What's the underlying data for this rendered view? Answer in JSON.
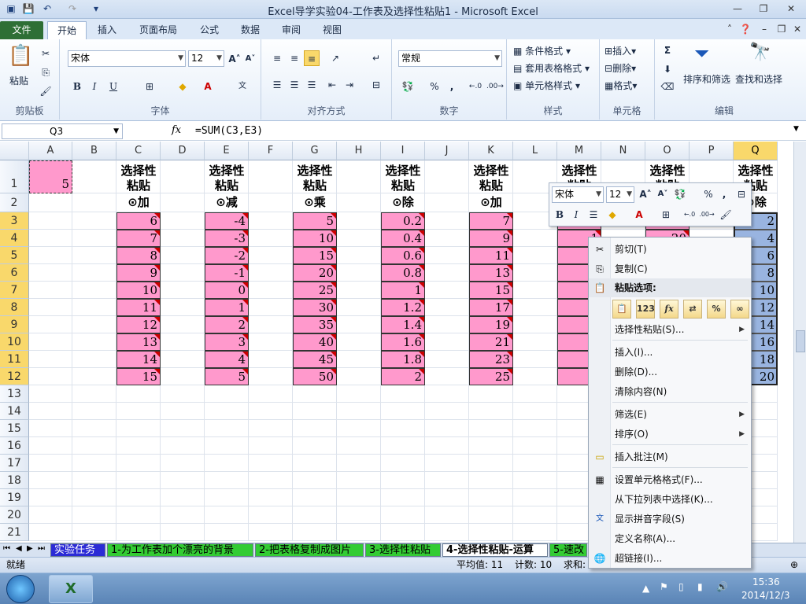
{
  "window": {
    "title": "Excel导学实验04-工作表及选择性粘贴1  -  Microsoft Excel"
  },
  "tabs": [
    "文件",
    "开始",
    "插入",
    "页面布局",
    "公式",
    "数据",
    "审阅",
    "视图"
  ],
  "ribbon": {
    "clipboard": {
      "paste": "粘贴",
      "label": "剪贴板"
    },
    "font": {
      "name": "宋体",
      "size": "12",
      "label": "字体"
    },
    "alignment": {
      "label": "对齐方式"
    },
    "number": {
      "format": "常规",
      "percent": "%",
      "comma": ",",
      "label": "数字"
    },
    "styles": {
      "conditional": "条件格式",
      "table": "套用表格格式",
      "cell": "单元格样式",
      "label": "样式"
    },
    "cells": {
      "insert": "插入",
      "delete": "删除",
      "format": "格式",
      "label": "单元格"
    },
    "editing": {
      "sort": "排序和筛选",
      "find": "查找和选择",
      "label": "编辑"
    }
  },
  "formula_bar": {
    "name_box": "Q3",
    "fx": "fx",
    "formula": "=SUM(C3,E3)"
  },
  "columns": [
    "A",
    "B",
    "C",
    "D",
    "E",
    "F",
    "G",
    "H",
    "I",
    "J",
    "K",
    "L",
    "M",
    "N",
    "O",
    "P",
    "Q"
  ],
  "rows": [
    "1",
    "2",
    "3",
    "4",
    "5",
    "6",
    "7",
    "8",
    "9",
    "10",
    "11",
    "12",
    "13",
    "14",
    "15",
    "16",
    "17",
    "18",
    "19",
    "20",
    "21"
  ],
  "sheet": {
    "a1": "5",
    "header_line1": "选择性",
    "header_line2": "粘贴",
    "ops": {
      "c": "⊙加",
      "e": "⊙减",
      "g": "⊙乘",
      "i": "⊙除",
      "k": "⊙加",
      "q": "⊙除"
    },
    "col_c": [
      "6",
      "7",
      "8",
      "9",
      "10",
      "11",
      "12",
      "13",
      "14",
      "15"
    ],
    "col_e": [
      "-4",
      "-3",
      "-2",
      "-1",
      "0",
      "1",
      "2",
      "3",
      "4",
      "5"
    ],
    "col_g": [
      "5",
      "10",
      "15",
      "20",
      "25",
      "30",
      "35",
      "40",
      "45",
      "50"
    ],
    "col_i": [
      "0.2",
      "0.4",
      "0.6",
      "0.8",
      "1",
      "1.2",
      "1.4",
      "1.6",
      "1.8",
      "2"
    ],
    "col_k": [
      "7",
      "9",
      "11",
      "13",
      "15",
      "17",
      "19",
      "21",
      "23",
      "25"
    ],
    "col_m_partial": [
      "0",
      "1",
      "2",
      "3",
      "4",
      "5",
      "6",
      "7",
      "8",
      "9"
    ],
    "col_o_partial": [
      "10",
      "20"
    ],
    "col_q": [
      "2",
      "4",
      "6",
      "8",
      "10",
      "12",
      "14",
      "16",
      "18",
      "20"
    ]
  },
  "minibar": {
    "font": "宋体",
    "size": "12",
    "percent": "%",
    "comma": ","
  },
  "context_menu": {
    "cut": "剪切(T)",
    "copy": "复制(C)",
    "paste_options": "粘贴选项:",
    "paste_special": "选择性粘贴(S)...",
    "insert": "插入(I)...",
    "delete": "删除(D)...",
    "clear": "清除内容(N)",
    "filter": "筛选(E)",
    "sort": "排序(O)",
    "comment": "插入批注(M)",
    "format_cells": "设置单元格格式(F)...",
    "pick_list": "从下拉列表中选择(K)...",
    "phonetic": "显示拼音字段(S)",
    "define_name": "定义名称(A)...",
    "hyperlink": "超链接(I)..."
  },
  "sheet_tabs": [
    {
      "label": "实验任务",
      "color": "#2b2bd6",
      "text": "#ffffff"
    },
    {
      "label": "1-为工作表加个漂亮的背景",
      "color": "#33cc33",
      "text": "#000000"
    },
    {
      "label": "2-把表格复制成图片",
      "color": "#33cc33",
      "text": "#000000"
    },
    {
      "label": "3-选择性粘贴",
      "color": "#33cc33",
      "text": "#000000"
    },
    {
      "label": "4-选择性粘贴-运算",
      "color": "#ffffff",
      "text": "#000000"
    },
    {
      "label": "5-速改",
      "color": "#33cc33",
      "text": "#000000"
    }
  ],
  "status": {
    "ready": "就绪",
    "avg": "平均值: 11",
    "count": "计数: 10",
    "sum": "求和:"
  },
  "taskbar": {
    "time": "15:36",
    "date": "2014/12/3"
  }
}
